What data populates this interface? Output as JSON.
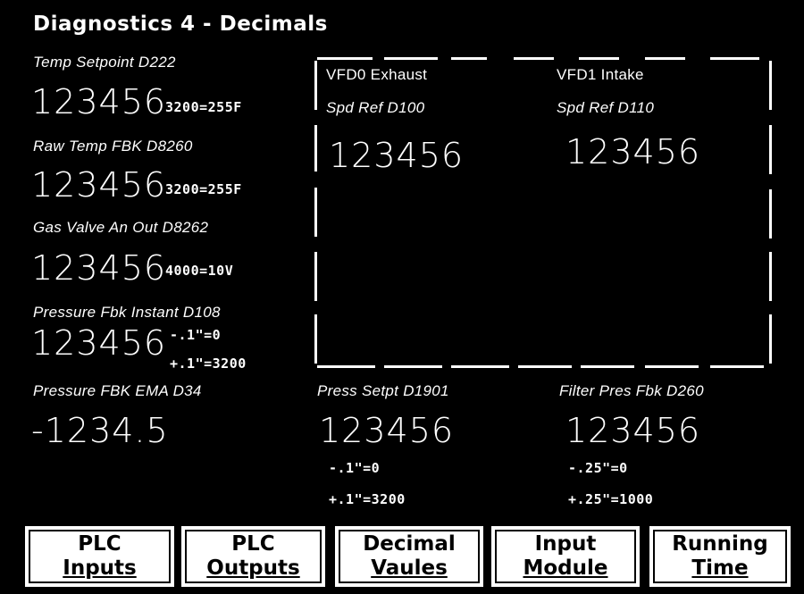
{
  "title": "Diagnostics 4 - Decimals",
  "left": {
    "temp_setpoint": {
      "label": "Temp Setpoint D222",
      "value": "123456",
      "note": "3200=255F"
    },
    "raw_temp_fbk": {
      "label": "Raw Temp FBK D8260",
      "value": "123456",
      "note": "3200=255F"
    },
    "gas_valve": {
      "label": "Gas Valve An Out D8262",
      "value": "123456",
      "note": "4000=10V"
    },
    "pressure_instant": {
      "label": "Pressure Fbk Instant D108",
      "value": "123456",
      "note1": "-.1\"=0",
      "note2": "+.1\"=3200"
    },
    "pressure_ema": {
      "label": "Pressure FBK EMA D34",
      "value": "-1234.5"
    }
  },
  "vfd": {
    "exhaust": {
      "label1": "VFD0 Exhaust",
      "label2": "Spd Ref D100",
      "value": "123456"
    },
    "intake": {
      "label1": "VFD1 Intake",
      "label2": "Spd Ref D110",
      "value": "123456"
    }
  },
  "bottom": {
    "press_setpt": {
      "label": "Press Setpt D1901",
      "value": "123456",
      "note1": "-.1\"=0",
      "note2": "+.1\"=3200"
    },
    "filter_press": {
      "label": "Filter Pres Fbk D260",
      "value": "123456",
      "note1": "-.25\"=0",
      "note2": "+.25\"=1000"
    }
  },
  "nav": [
    {
      "line1": "PLC",
      "line2": "Inputs"
    },
    {
      "line1": "PLC",
      "line2": "Outputs"
    },
    {
      "line1": "Decimal",
      "line2": "Vaules"
    },
    {
      "line1": "Input",
      "line2": "Module"
    },
    {
      "line1": "Running",
      "line2": "Time"
    }
  ]
}
